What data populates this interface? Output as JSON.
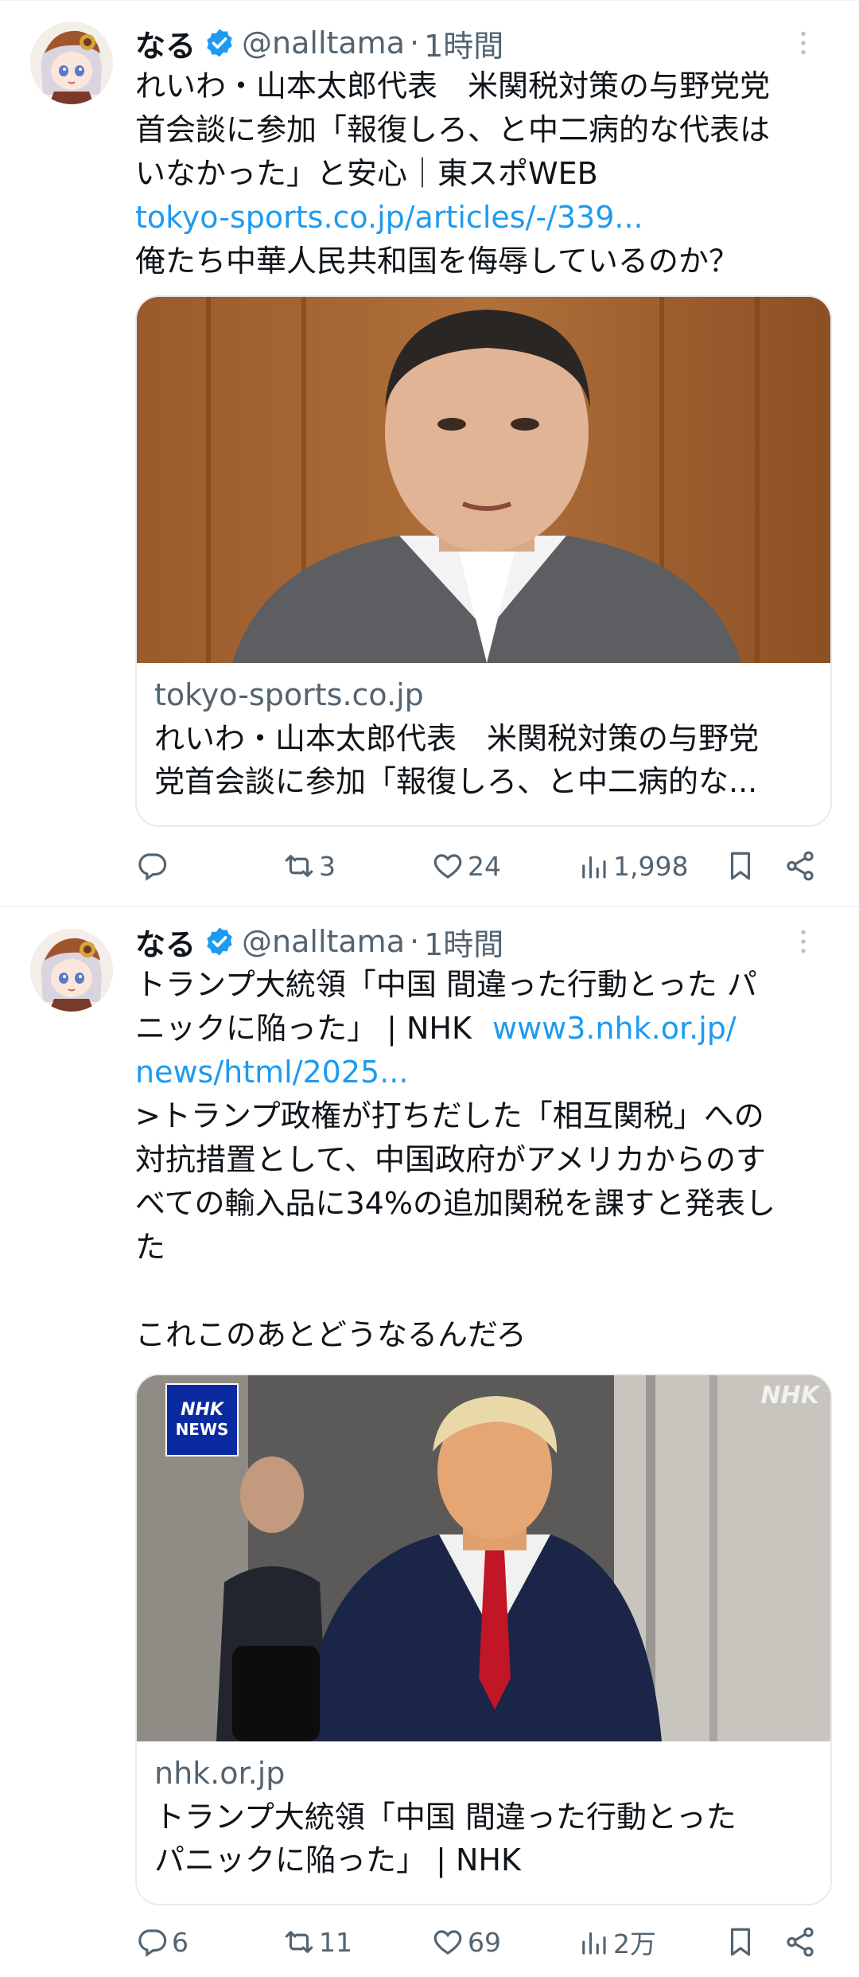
{
  "tweets": [
    {
      "author": {
        "name": "なる",
        "handle": "@nalltama",
        "time": "1時間",
        "verified": true
      },
      "text_lines": [
        "れいわ・山本太郎代表　米関税対策の与野党党",
        "首会談に参加「報復しろ、と中二病的な代表は",
        "いなかった」と安心｜東スポWEB"
      ],
      "link": "tokyo-sports.co.jp/articles/-/339...",
      "comment": "俺たち中華人民共和国を侮辱しているのか？",
      "card": {
        "domain": "tokyo-sports.co.jp",
        "title_lines": [
          "れいわ・山本太郎代表　米関税対策の与野党",
          "党首会談に参加「報復しろ、と中二病的な..."
        ]
      },
      "actions": {
        "reply": "",
        "retweet": "3",
        "like": "24",
        "views": "1,998"
      }
    },
    {
      "author": {
        "name": "なる",
        "handle": "@nalltama",
        "time": "1時間",
        "verified": true
      },
      "text_line1": "トランプ大統領「中国 間違った行動とった パ",
      "text_line2_prefix": "ニックに陥った」 | NHK",
      "link_part1": "www3.nhk.or.jp/",
      "link_part2": "news/html/2025...",
      "quote_lines": [
        ">トランプ政権が打ちだした「相互関税」への",
        "対抗措置として、中国政府がアメリカからのす",
        "べての輸入品に34%の追加関税を課すと発表し",
        "た"
      ],
      "comment": "これこのあとどうなるんだろ",
      "card": {
        "domain": "nhk.or.jp",
        "badge_line1": "NHK",
        "badge_line2": "NEWS",
        "watermark": "NHK",
        "title_lines": [
          "トランプ大統領「中国 間違った行動とった",
          "パニックに陥った」 | NHK"
        ]
      },
      "actions": {
        "reply": "6",
        "retweet": "11",
        "like": "69",
        "views": "2万"
      }
    }
  ],
  "colors": {
    "link": "#1d9bf0",
    "secondary_text": "#536471",
    "verified": "#1d9bf0",
    "divider": "#eff3f4"
  }
}
